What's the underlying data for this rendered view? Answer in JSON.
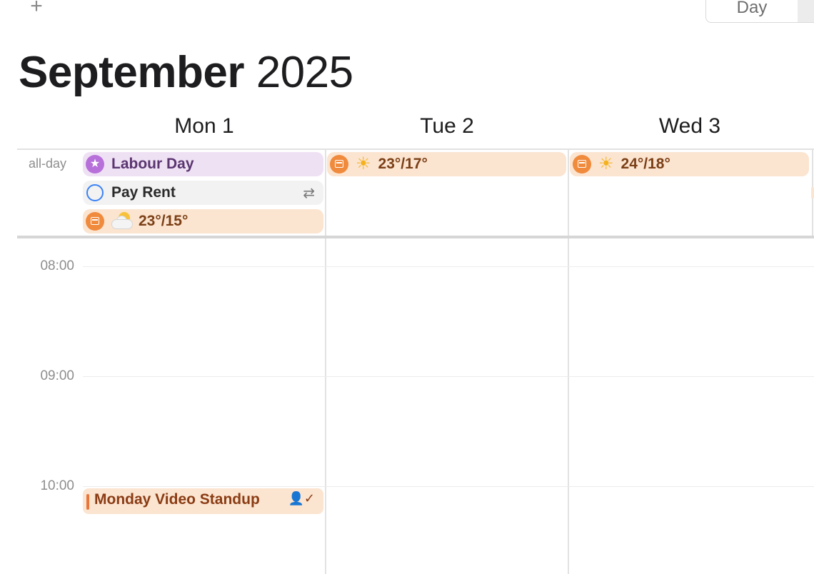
{
  "toolbar": {
    "add_icon": "+",
    "view_day_label": "Day"
  },
  "header": {
    "month": "September",
    "year": "2025"
  },
  "days": [
    {
      "label": "Mon 1"
    },
    {
      "label": "Tue 2"
    },
    {
      "label": "Wed 3"
    }
  ],
  "allday": {
    "label": "all-day",
    "mon": {
      "holiday": {
        "title": "Labour Day",
        "icon": "star-icon",
        "color": "#b770d9"
      },
      "reminder": {
        "title": "Pay Rent",
        "icon": "circle-icon",
        "repeat_icon": "repeat-icon"
      },
      "weather": {
        "text": "23°/15°",
        "icon": "partly-cloudy-icon"
      }
    },
    "tue": {
      "weather": {
        "text": "23°/17°",
        "icon": "sun-icon"
      }
    },
    "wed": {
      "weather": {
        "text": "24°/18°",
        "icon": "sun-icon"
      }
    }
  },
  "times": [
    "08:00",
    "09:00",
    "10:00"
  ],
  "events": [
    {
      "title": "Monday Video Standup",
      "day": "Mon 1",
      "start": "10:00",
      "color": "#e8763a",
      "icon": "attendee-icon"
    }
  ],
  "colors": {
    "holiday_bg": "#efe1f4",
    "weather_bg": "#fbe4d0",
    "reminder_ring": "#3b82f6",
    "calendar_orange": "#f08a3c"
  }
}
